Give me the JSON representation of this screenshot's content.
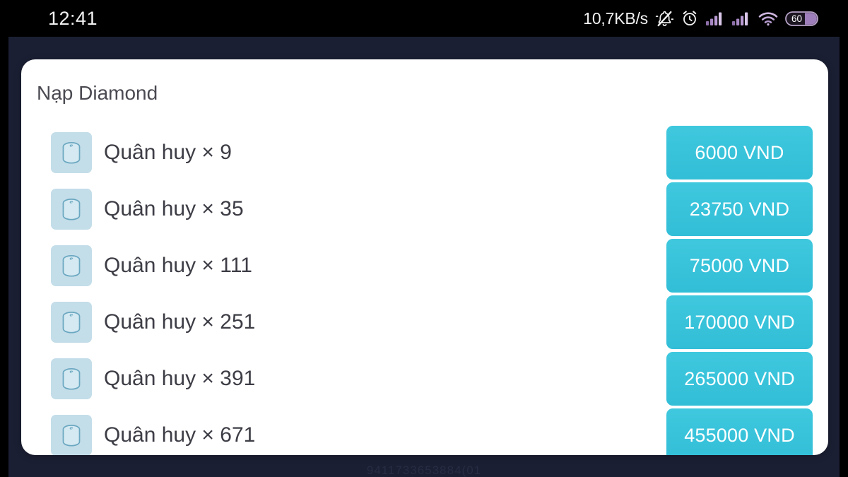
{
  "status_bar": {
    "clock": "12:41",
    "network_speed": "10,7KB/s",
    "icons": [
      "bell-muted-icon",
      "alarm-clock-icon",
      "signal-bars-icon",
      "signal-bars-icon",
      "wifi-icon",
      "battery-icon"
    ],
    "battery_level": "60"
  },
  "background": {
    "faint_text": "9411733653884(01",
    "color": "#1b1f33"
  },
  "card": {
    "title": "Nạp Diamond",
    "background": "#ffffff",
    "accent_color": "#3fc8de",
    "icon_tile_color": "#c3dde9",
    "rows": [
      {
        "icon": "coin-stack-icon",
        "label": "Quân huy × 9",
        "price": "6000 VND"
      },
      {
        "icon": "coin-stack-icon",
        "label": "Quân huy × 35",
        "price": "23750 VND"
      },
      {
        "icon": "coin-stack-icon",
        "label": "Quân huy × 111",
        "price": "75000 VND"
      },
      {
        "icon": "coin-stack-icon",
        "label": "Quân huy × 251",
        "price": "170000 VND"
      },
      {
        "icon": "coin-stack-icon",
        "label": "Quân huy × 391",
        "price": "265000 VND"
      },
      {
        "icon": "coin-stack-icon",
        "label": "Quân huy × 671",
        "price": "455000 VND"
      }
    ]
  }
}
